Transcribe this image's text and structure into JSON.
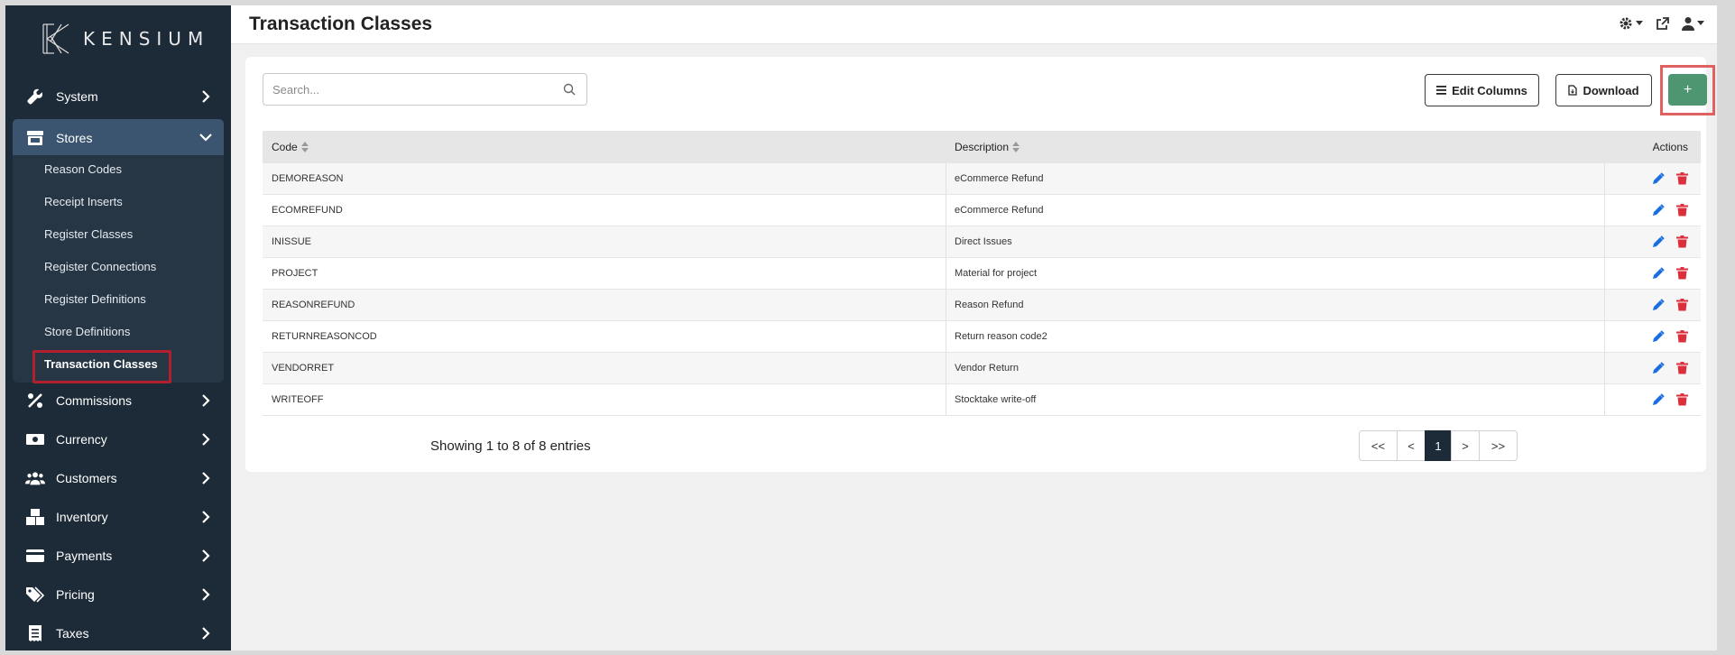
{
  "app": {
    "logo_text": "KENSIUM"
  },
  "sidebar": {
    "items": [
      {
        "label": "System",
        "icon": "wrench-icon"
      },
      {
        "label": "Stores",
        "icon": "store-icon",
        "expanded": true
      },
      {
        "label": "Commissions",
        "icon": "percent-icon"
      },
      {
        "label": "Currency",
        "icon": "money-icon"
      },
      {
        "label": "Customers",
        "icon": "users-icon"
      },
      {
        "label": "Inventory",
        "icon": "boxes-icon"
      },
      {
        "label": "Payments",
        "icon": "credit-card-icon"
      },
      {
        "label": "Pricing",
        "icon": "tags-icon"
      },
      {
        "label": "Taxes",
        "icon": "receipt-icon"
      }
    ],
    "stores_submenu": [
      "Reason Codes",
      "Receipt Inserts",
      "Register Classes",
      "Register Connections",
      "Register Definitions",
      "Store Definitions",
      "Transaction Classes"
    ],
    "current": "Transaction Classes"
  },
  "header": {
    "title": "Transaction Classes",
    "icons": [
      "gear-icon",
      "external-link-icon",
      "user-icon"
    ]
  },
  "toolbar": {
    "search_placeholder": "Search...",
    "edit_columns_label": "Edit Columns",
    "download_label": "Download",
    "add_label": "+"
  },
  "table": {
    "columns": {
      "code": "Code",
      "description": "Description",
      "actions": "Actions"
    },
    "rows": [
      {
        "code": "DEMOREASON",
        "description": "eCommerce Refund"
      },
      {
        "code": "ECOMREFUND",
        "description": "eCommerce Refund"
      },
      {
        "code": "INISSUE",
        "description": "Direct Issues"
      },
      {
        "code": "PROJECT",
        "description": "Material for project"
      },
      {
        "code": "REASONREFUND",
        "description": "Reason Refund"
      },
      {
        "code": "RETURNREASONCOD",
        "description": "Return reason code2"
      },
      {
        "code": "VENDORRET",
        "description": "Vendor Return"
      },
      {
        "code": "WRITEOFF",
        "description": "Stocktake write-off"
      }
    ]
  },
  "footer": {
    "showing": "Showing 1 to 8 of 8 entries",
    "pager": {
      "first": "<<",
      "prev": "<",
      "current": "1",
      "next": ">",
      "last": ">>"
    }
  },
  "colors": {
    "sidebar_bg": "#1d2a37",
    "active_item": "#3b5570",
    "add_button": "#4e9672",
    "edit_icon": "#1a6fe0",
    "delete_icon": "#dc2f3c"
  }
}
